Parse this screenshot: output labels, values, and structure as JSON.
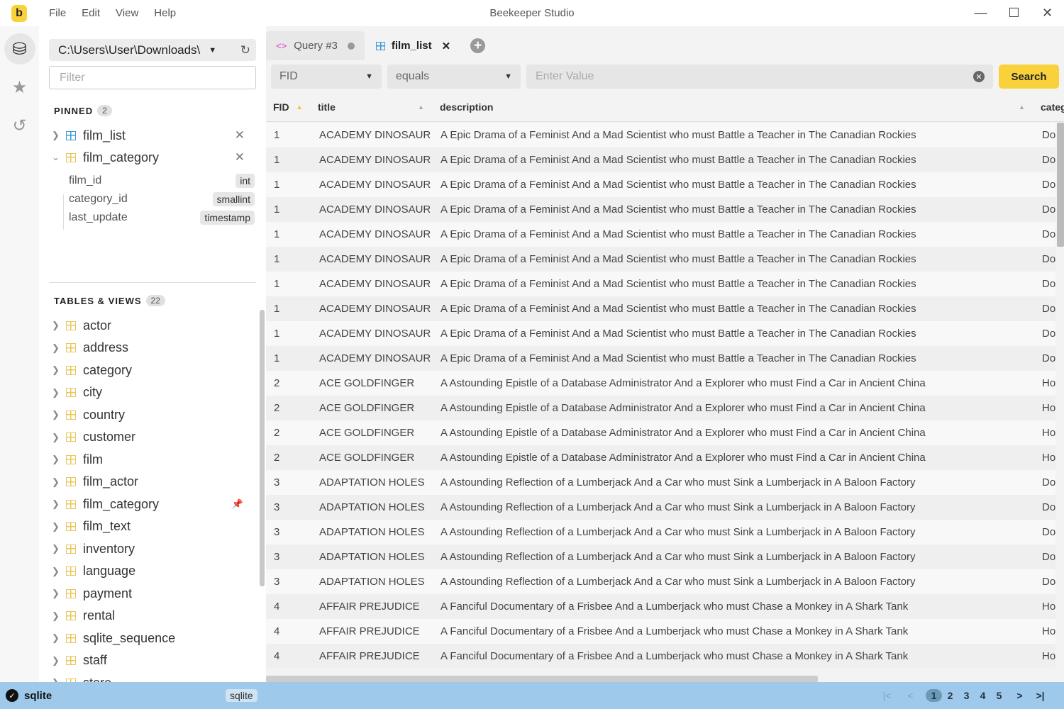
{
  "app": {
    "title": "Beekeeper Studio",
    "logo": "b",
    "menu": [
      "File",
      "Edit",
      "View",
      "Help"
    ]
  },
  "rail": {
    "icons": [
      "database-icon",
      "star-icon",
      "history-icon"
    ]
  },
  "sidebar": {
    "connection": "C:\\Users\\User\\Downloads\\",
    "filter_placeholder": "Filter",
    "pinned_label": "PINNED",
    "pinned_count": "2",
    "pinned": [
      {
        "name": "film_list",
        "expanded": false
      },
      {
        "name": "film_category",
        "expanded": true
      }
    ],
    "columns": [
      {
        "name": "film_id",
        "type": "int"
      },
      {
        "name": "category_id",
        "type": "smallint"
      },
      {
        "name": "last_update",
        "type": "timestamp"
      }
    ],
    "tables_label": "TABLES & VIEWS",
    "tables_count": "22",
    "tables": [
      "actor",
      "address",
      "category",
      "city",
      "country",
      "customer",
      "film",
      "film_actor",
      "film_category",
      "film_text",
      "inventory",
      "language",
      "payment",
      "rental",
      "sqlite_sequence",
      "staff",
      "store"
    ]
  },
  "tabs": [
    {
      "label": "Query #3",
      "active": false
    },
    {
      "label": "film_list",
      "active": true
    }
  ],
  "filterbar": {
    "column": "FID",
    "operator": "equals",
    "value_placeholder": "Enter Value",
    "search_label": "Search"
  },
  "table": {
    "columns": [
      "FID",
      "title",
      "description",
      "category"
    ],
    "rows": [
      [
        "1",
        "ACADEMY DINOSAUR",
        "A Epic Drama of a Feminist And a Mad Scientist who must Battle a Teacher in The Canadian Rockies",
        "Documentary"
      ],
      [
        "1",
        "ACADEMY DINOSAUR",
        "A Epic Drama of a Feminist And a Mad Scientist who must Battle a Teacher in The Canadian Rockies",
        "Documentary"
      ],
      [
        "1",
        "ACADEMY DINOSAUR",
        "A Epic Drama of a Feminist And a Mad Scientist who must Battle a Teacher in The Canadian Rockies",
        "Documentary"
      ],
      [
        "1",
        "ACADEMY DINOSAUR",
        "A Epic Drama of a Feminist And a Mad Scientist who must Battle a Teacher in The Canadian Rockies",
        "Documentary"
      ],
      [
        "1",
        "ACADEMY DINOSAUR",
        "A Epic Drama of a Feminist And a Mad Scientist who must Battle a Teacher in The Canadian Rockies",
        "Documentary"
      ],
      [
        "1",
        "ACADEMY DINOSAUR",
        "A Epic Drama of a Feminist And a Mad Scientist who must Battle a Teacher in The Canadian Rockies",
        "Documentary"
      ],
      [
        "1",
        "ACADEMY DINOSAUR",
        "A Epic Drama of a Feminist And a Mad Scientist who must Battle a Teacher in The Canadian Rockies",
        "Documentary"
      ],
      [
        "1",
        "ACADEMY DINOSAUR",
        "A Epic Drama of a Feminist And a Mad Scientist who must Battle a Teacher in The Canadian Rockies",
        "Documentary"
      ],
      [
        "1",
        "ACADEMY DINOSAUR",
        "A Epic Drama of a Feminist And a Mad Scientist who must Battle a Teacher in The Canadian Rockies",
        "Documentary"
      ],
      [
        "1",
        "ACADEMY DINOSAUR",
        "A Epic Drama of a Feminist And a Mad Scientist who must Battle a Teacher in The Canadian Rockies",
        "Documentary"
      ],
      [
        "2",
        "ACE GOLDFINGER",
        "A Astounding Epistle of a Database Administrator And a Explorer who must Find a Car in Ancient China",
        "Horror"
      ],
      [
        "2",
        "ACE GOLDFINGER",
        "A Astounding Epistle of a Database Administrator And a Explorer who must Find a Car in Ancient China",
        "Horror"
      ],
      [
        "2",
        "ACE GOLDFINGER",
        "A Astounding Epistle of a Database Administrator And a Explorer who must Find a Car in Ancient China",
        "Horror"
      ],
      [
        "2",
        "ACE GOLDFINGER",
        "A Astounding Epistle of a Database Administrator And a Explorer who must Find a Car in Ancient China",
        "Horror"
      ],
      [
        "3",
        "ADAPTATION HOLES",
        "A Astounding Reflection of a Lumberjack And a Car who must Sink a Lumberjack in A Baloon Factory",
        "Documentary"
      ],
      [
        "3",
        "ADAPTATION HOLES",
        "A Astounding Reflection of a Lumberjack And a Car who must Sink a Lumberjack in A Baloon Factory",
        "Documentary"
      ],
      [
        "3",
        "ADAPTATION HOLES",
        "A Astounding Reflection of a Lumberjack And a Car who must Sink a Lumberjack in A Baloon Factory",
        "Documentary"
      ],
      [
        "3",
        "ADAPTATION HOLES",
        "A Astounding Reflection of a Lumberjack And a Car who must Sink a Lumberjack in A Baloon Factory",
        "Documentary"
      ],
      [
        "3",
        "ADAPTATION HOLES",
        "A Astounding Reflection of a Lumberjack And a Car who must Sink a Lumberjack in A Baloon Factory",
        "Documentary"
      ],
      [
        "4",
        "AFFAIR PREJUDICE",
        "A Fanciful Documentary of a Frisbee And a Lumberjack who must Chase a Monkey in A Shark Tank",
        "Horror"
      ],
      [
        "4",
        "AFFAIR PREJUDICE",
        "A Fanciful Documentary of a Frisbee And a Lumberjack who must Chase a Monkey in A Shark Tank",
        "Horror"
      ],
      [
        "4",
        "AFFAIR PREJUDICE",
        "A Fanciful Documentary of a Frisbee And a Lumberjack who must Chase a Monkey in A Shark Tank",
        "Horror"
      ]
    ]
  },
  "status": {
    "connection": "sqlite",
    "type": "sqlite",
    "pages": [
      "1",
      "2",
      "3",
      "4",
      "5"
    ],
    "current_page": "1"
  },
  "colors": {
    "accent": "#f9d23b",
    "statusbar": "#9fc9ea",
    "table_icon": "#e8c75a",
    "tab_table_icon": "#3a9ad9"
  }
}
